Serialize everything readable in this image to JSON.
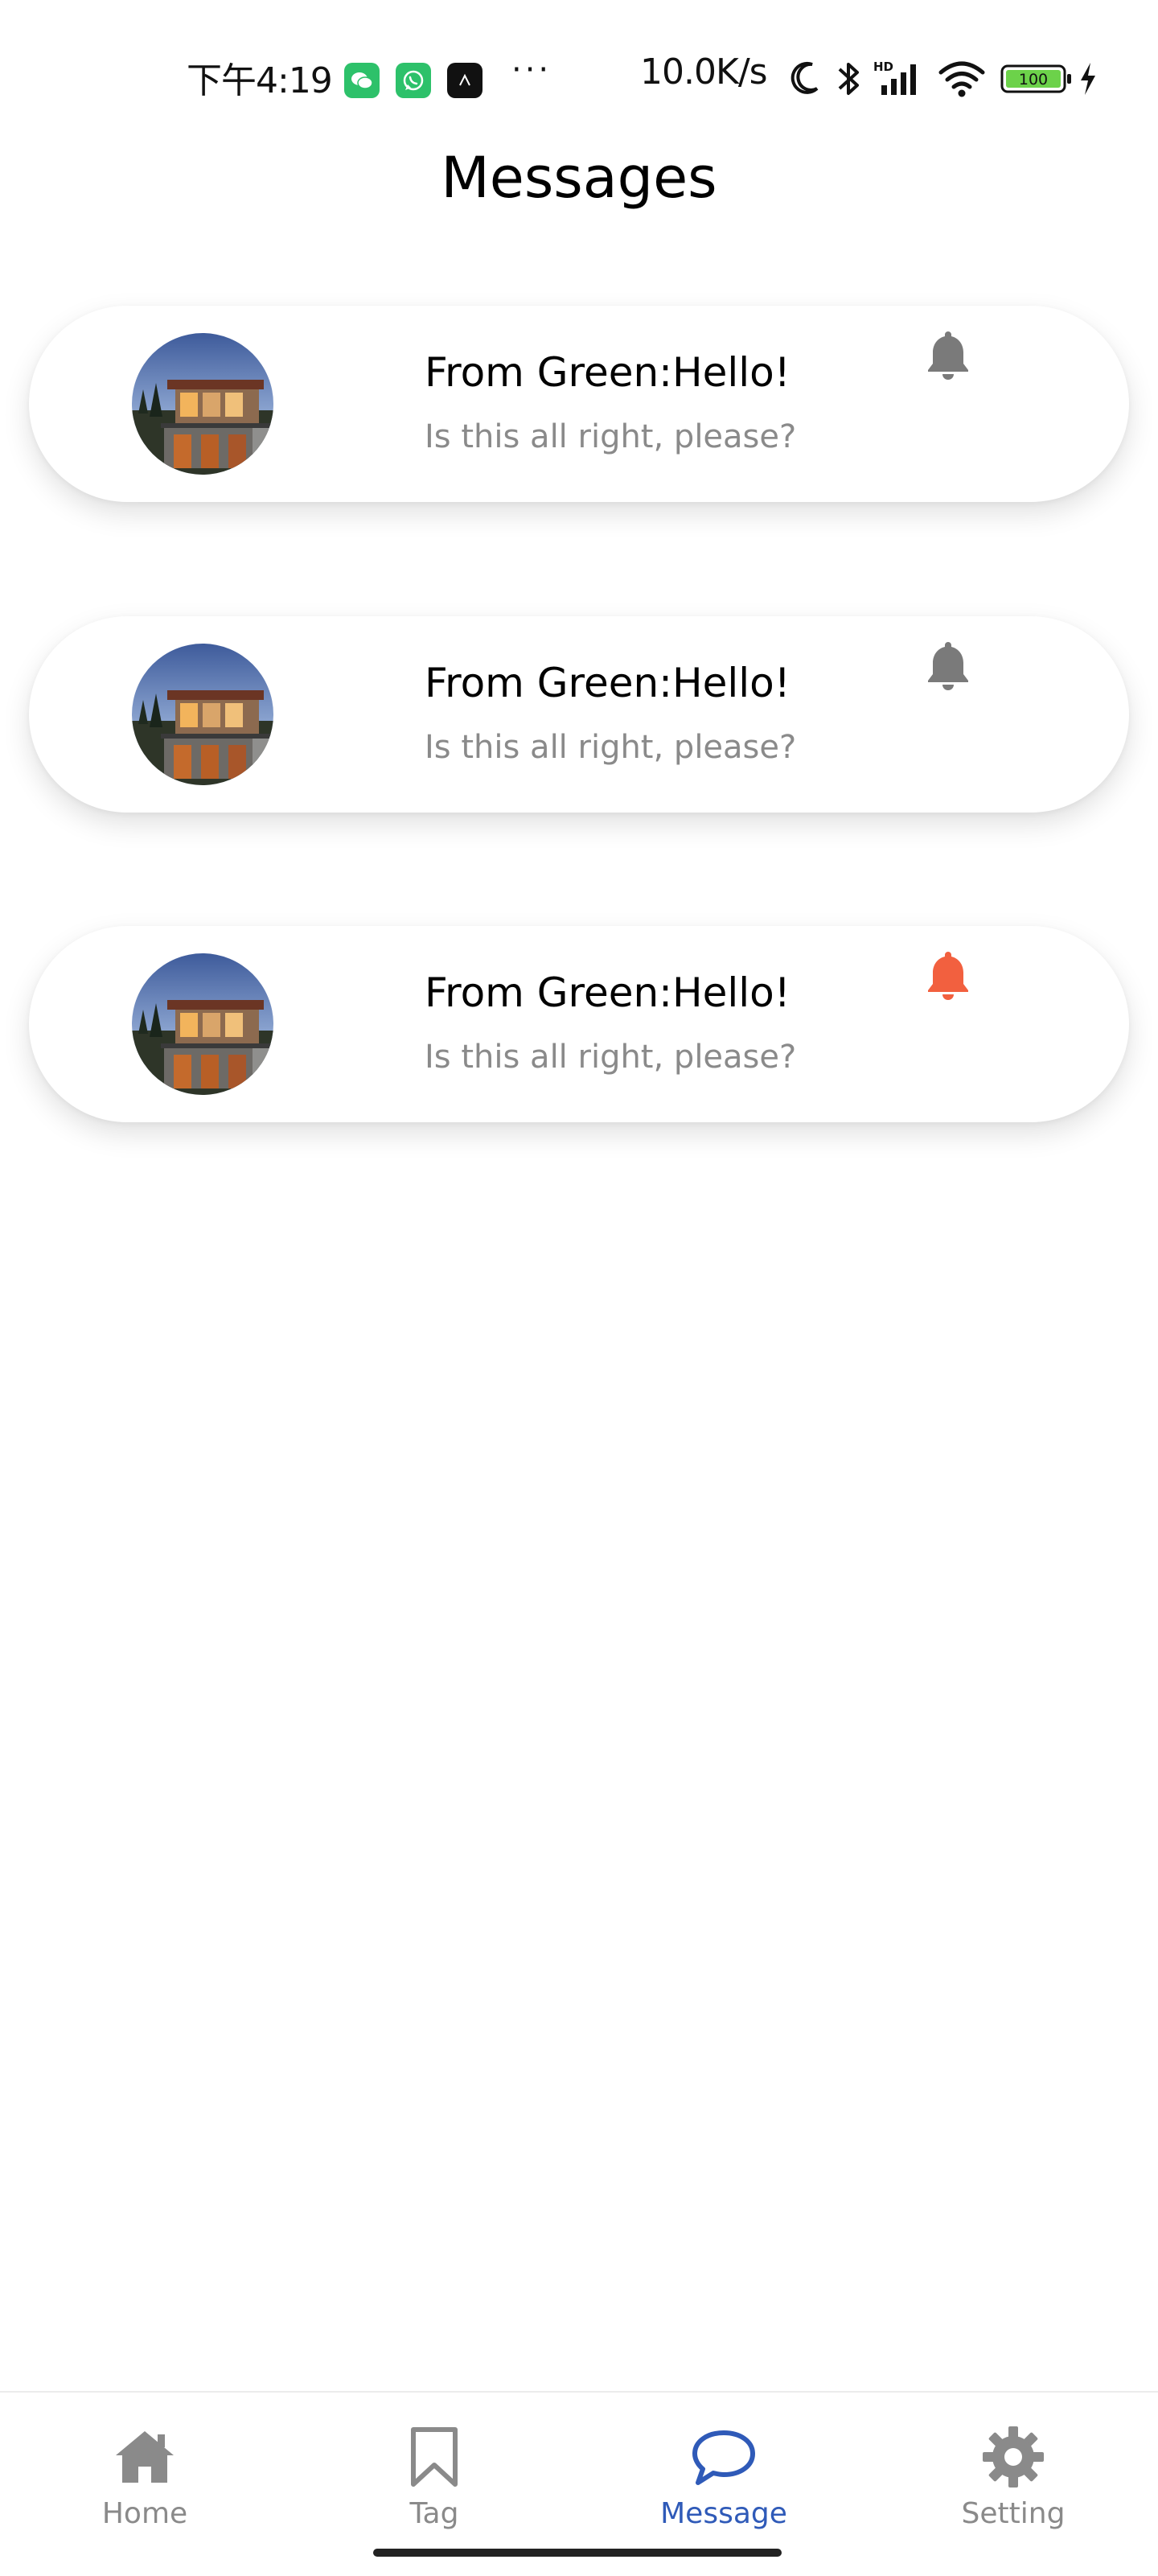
{
  "status_bar": {
    "time": "下午4:19",
    "more": "···",
    "network_speed": "10.0K/s",
    "network_type": "HD",
    "battery": "100"
  },
  "page": {
    "title": "Messages"
  },
  "messages": [
    {
      "title": "From Green:Hello!",
      "subtitle": "Is this all right, please?",
      "bell_icon": "bell-icon",
      "bell_color": "#7a7a7a"
    },
    {
      "title": "From Green:Hello!",
      "subtitle": "Is this all right, please?",
      "bell_icon": "bell-icon",
      "bell_color": "#7a7a7a"
    },
    {
      "title": "From Green:Hello!",
      "subtitle": "Is this all right, please?",
      "bell_icon": "bell-icon",
      "bell_color": "#f2603f"
    }
  ],
  "bottom_nav": {
    "items": [
      {
        "label": "Home",
        "icon": "home-icon",
        "active": false
      },
      {
        "label": "Tag",
        "icon": "bookmark-icon",
        "active": false
      },
      {
        "label": "Message",
        "icon": "chat-bubble-icon",
        "active": true
      },
      {
        "label": "Setting",
        "icon": "gear-icon",
        "active": false
      }
    ]
  },
  "colors": {
    "accent": "#2f5ab8",
    "inactive": "#8a8a8a",
    "alert": "#f2603f",
    "text": "#000000",
    "subtitle": "#8a8a8a"
  }
}
